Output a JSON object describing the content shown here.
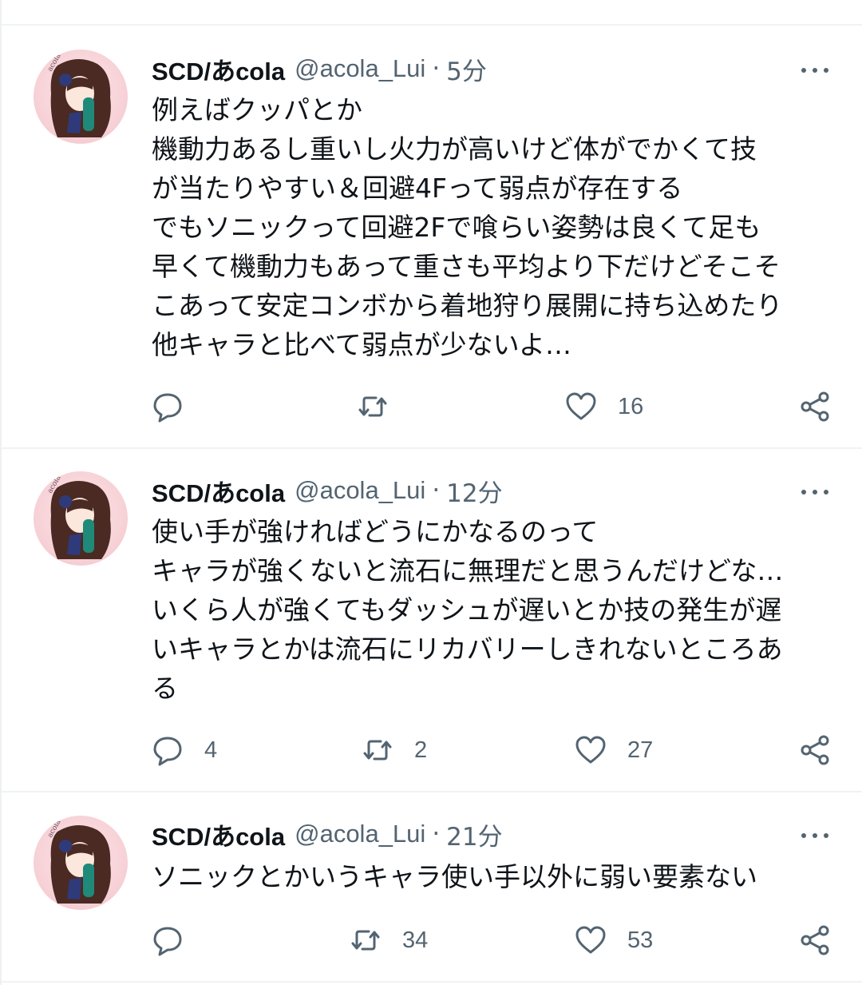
{
  "colors": {
    "text_primary": "#0f1419",
    "text_secondary": "#536471",
    "divider": "#eff3f4"
  },
  "icons": {
    "reply": "speech-bubble-icon",
    "retweet": "retweet-arrows-icon",
    "like": "heart-icon",
    "share": "share-nodes-icon",
    "more": "ellipsis-icon"
  },
  "tweets": [
    {
      "name": "SCD/あcola",
      "handle": "@acola_Lui",
      "separator": "·",
      "time": "5分",
      "text": "例えばクッパとか\n機動力あるし重いし火力が高いけど体がでかくて技\nが当たりやすい＆回避4Fって弱点が存在する\nでもソニックって回避2Fで喰らい姿勢は良くて足も\n早くて機動力もあって重さも平均より下だけどそこそ\nこあって安定コンボから着地狩り展開に持ち込めたり\n他キャラと比べて弱点が少ないよ…",
      "replies": "",
      "retweets": "",
      "likes": "16"
    },
    {
      "name": "SCD/あcola",
      "handle": "@acola_Lui",
      "separator": "·",
      "time": "12分",
      "text": "使い手が強ければどうにかなるのって\nキャラが強くないと流石に無理だと思うんだけどな…\nいくら人が強くてもダッシュが遅いとか技の発生が遅\nいキャラとかは流石にリカバリーしきれないところあ\nる",
      "replies": "4",
      "retweets": "2",
      "likes": "27"
    },
    {
      "name": "SCD/あcola",
      "handle": "@acola_Lui",
      "separator": "·",
      "time": "21分",
      "text": "ソニックとかいうキャラ使い手以外に弱い要素ない",
      "replies": "",
      "retweets": "34",
      "likes": "53"
    }
  ]
}
